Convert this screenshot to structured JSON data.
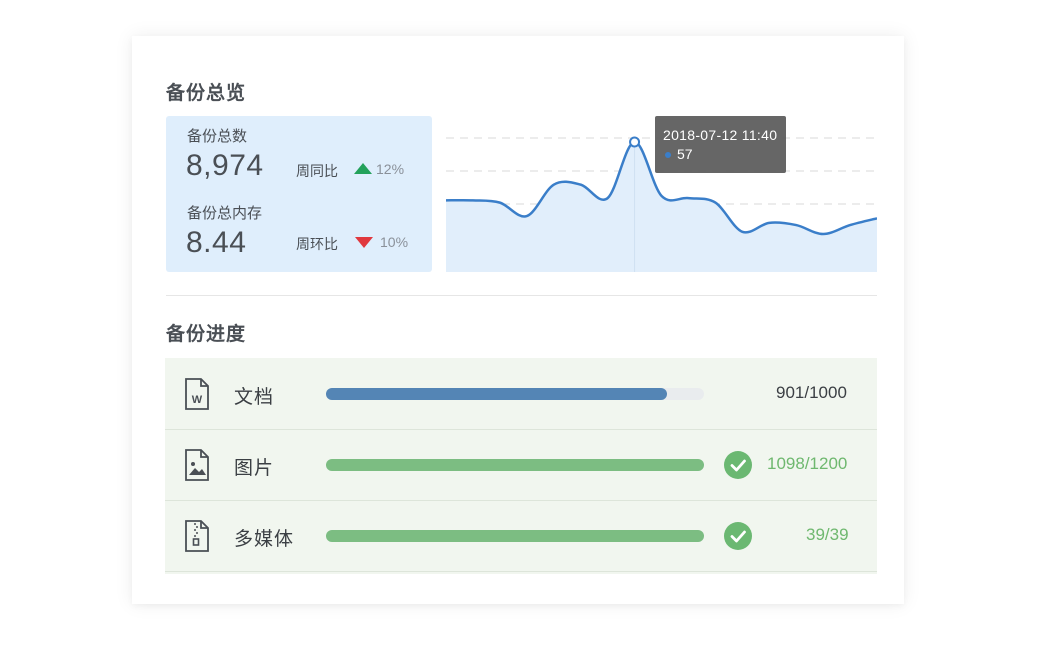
{
  "overview": {
    "title": "备份总览",
    "total_count_label": "备份总数",
    "total_count_value": "8,974",
    "week_yoy_label": "周同比",
    "week_yoy_value": "12%",
    "total_storage_label": "备份总内存",
    "total_storage_value": "8.44",
    "week_mom_label": "周环比",
    "week_mom_value": "10%"
  },
  "chart_data": {
    "type": "area",
    "x": [
      "",
      "",
      "",
      "",
      "",
      "",
      "",
      "",
      "",
      "",
      "",
      "",
      "",
      "",
      "",
      "",
      ""
    ],
    "series": [
      {
        "values": [
          31,
          31,
          30,
          24,
          38,
          38,
          32,
          57,
          33,
          32,
          30,
          17,
          21,
          20,
          16,
          20,
          23
        ]
      }
    ],
    "ylim": [
      0,
      65
    ],
    "grid": true,
    "tooltip": {
      "time": "2018-07-12  11:40",
      "value": "57",
      "index": 7
    },
    "colors": {
      "line": "#3a7ec9",
      "area": "#e1eefb",
      "grid": "#d9d9d9"
    }
  },
  "progress": {
    "title": "备份进度",
    "items": [
      {
        "name": "文档",
        "icon": "word-document-icon",
        "count": "901/1000",
        "fraction": 0.901,
        "complete": false,
        "color": "#5485b5"
      },
      {
        "name": "图片",
        "icon": "image-file-icon",
        "count": "1098/1200",
        "fraction": 1.0,
        "complete": true,
        "color": "#7cbd82"
      },
      {
        "name": "多媒体",
        "icon": "zip-file-icon",
        "count": "39/39",
        "fraction": 1.0,
        "complete": true,
        "color": "#7cbd82"
      }
    ],
    "count_complete_color": "#6fb86f",
    "count_default_color": "#3b3f44"
  }
}
